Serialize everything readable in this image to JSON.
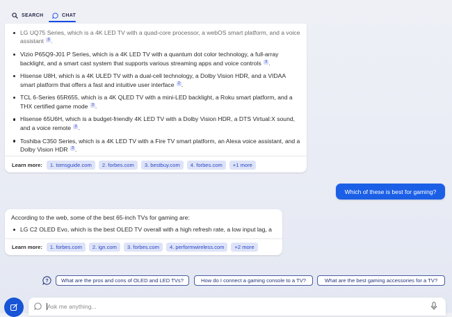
{
  "tabs": {
    "search_label": "SEARCH",
    "chat_label": "CHAT",
    "search_icon": "search-icon",
    "chat_icon": "chat-bubble-icon"
  },
  "messages": {
    "first_response": {
      "items": [
        {
          "text": "LG UQ75 Series, which is a 4K LED TV with a quad-core processor, a webOS smart platform, and a voice assistant",
          "cite": "3"
        },
        {
          "text": "Vizio P65Q9-J01 P Series, which is a 4K LED TV with a quantum dot color technology, a full-array backlight, and a smart cast system that supports various streaming apps and voice controls",
          "cite": "3"
        },
        {
          "text": "Hisense U8H, which is a 4K ULED TV with a dual-cell technology, a Dolby Vision HDR, and a VIDAA smart platform that offers a fast and intuitive user interface",
          "cite": "2"
        },
        {
          "text": "TCL 6-Series 65R655, which is a 4K QLED TV with a mini-LED backlight, a Roku smart platform, and a THX certified game mode",
          "cite": "3"
        },
        {
          "text": "Hisense 65U6H, which is a budget-friendly 4K LED TV with a Dolby Vision HDR, a DTS Virtual:X sound, and a voice remote",
          "cite": "3"
        },
        {
          "text": "Toshiba C350 Series, which is a 4K LED TV with a Fire TV smart platform, an Alexa voice assistant, and a Dolby Vision HDR",
          "cite": "3"
        }
      ],
      "learn_more_label": "Learn more:",
      "sources": [
        "1. tomsguide.com",
        "2. forbes.com",
        "3. bestbuy.com",
        "4. forbes.com",
        "+1 more"
      ]
    },
    "user_question": "Which of these is best for gaming?",
    "second_response": {
      "intro": "According to the web, some of the best 65-inch TVs for gaming are:",
      "items": [
        {
          "text": "LG C2 OLED Evo, which is the best OLED TV overall with a high refresh rate, a low input lag, a"
        }
      ],
      "learn_more_label": "Learn more:",
      "sources": [
        "1. forbes.com",
        "2. ign.com",
        "3. forbes.com",
        "4. performwireless.com",
        "+2 more"
      ]
    }
  },
  "suggestions": [
    "What are the pros and cons of OLED and LED TVs?",
    "How do I connect a gaming console to a TV?",
    "What are the best gaming accessories for a TV?"
  ],
  "composer": {
    "placeholder": "Ask me anything...",
    "new_topic_icon": "new-topic-icon",
    "mic_icon": "microphone-icon"
  },
  "colors": {
    "accent": "#1b5fe6",
    "chip_bg": "#dde3f8",
    "chip_text": "#2c47c4"
  }
}
